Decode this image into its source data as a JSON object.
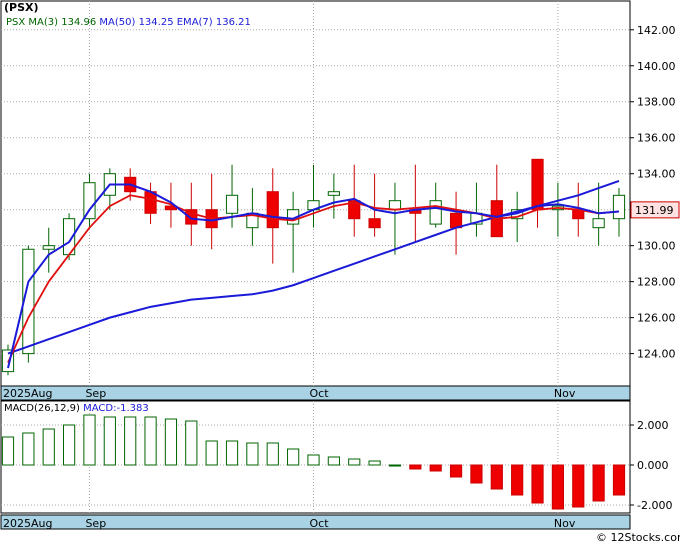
{
  "chart_data": [
    {
      "type": "candlestick",
      "title": "(PSX)",
      "ticker": "PSX",
      "legend": [
        {
          "label": "MA(3)",
          "value": "134.96",
          "color": "#2a2ad8"
        },
        {
          "label": "MA(50)",
          "value": "134.25",
          "color": "#2a2ad8"
        },
        {
          "label": "EMA(7)",
          "value": "136.21",
          "color": "#2a2ad8"
        }
      ],
      "ylim": [
        122.2,
        143.6
      ],
      "yticks": [
        "142.00",
        "140.00",
        "138.00",
        "136.00",
        "134.00",
        "132.00",
        "130.00",
        "128.00",
        "126.00",
        "124.00"
      ],
      "ytick_values": [
        142,
        140,
        138,
        136,
        134,
        132,
        130,
        128,
        126,
        124
      ],
      "last_price": "131.99",
      "xlabels": [
        {
          "label": "2025Aug",
          "index": 0
        },
        {
          "label": "Sep",
          "index": 4
        },
        {
          "label": "Oct",
          "index": 15
        },
        {
          "label": "Nov",
          "index": 27
        }
      ],
      "ohlc": [
        [
          123,
          124.5,
          122.8,
          124.2
        ],
        [
          124,
          130,
          123.5,
          129.8
        ],
        [
          129.8,
          131,
          128.5,
          130
        ],
        [
          129.5,
          131.8,
          129.2,
          131.5
        ],
        [
          131.5,
          134,
          131,
          133.5
        ],
        [
          132.8,
          134.3,
          132,
          134
        ],
        [
          133.8,
          134.3,
          132.5,
          133
        ],
        [
          133,
          133.5,
          131.2,
          131.8
        ],
        [
          132.2,
          133.5,
          131,
          132
        ],
        [
          132,
          133.5,
          130,
          131.2
        ],
        [
          132,
          134,
          129.8,
          131
        ],
        [
          131.8,
          134.5,
          131,
          132.8
        ],
        [
          131,
          133.2,
          130,
          131.8
        ],
        [
          133,
          134.3,
          129,
          131
        ],
        [
          131.2,
          133,
          128.5,
          132
        ],
        [
          132,
          134.5,
          131,
          132.5
        ],
        [
          132.8,
          134,
          131.5,
          133
        ],
        [
          132.5,
          134.5,
          130.5,
          131.5
        ],
        [
          131.5,
          134,
          130.5,
          131
        ],
        [
          132,
          133.5,
          129.5,
          132.5
        ],
        [
          132,
          134.5,
          130.2,
          131.8
        ],
        [
          131.2,
          133.5,
          131,
          132.5
        ],
        [
          131.8,
          133,
          129.5,
          131
        ],
        [
          131.2,
          133.5,
          130.5,
          131.8
        ],
        [
          132.5,
          134.5,
          130.8,
          130.5
        ],
        [
          131.5,
          133,
          130.2,
          132
        ],
        [
          134.8,
          134.5,
          131,
          132
        ],
        [
          132,
          133.5,
          130.5,
          132.2
        ],
        [
          132,
          133.5,
          130.5,
          131.5
        ],
        [
          131,
          133.5,
          130,
          131.5
        ],
        [
          131.5,
          133.2,
          130.5,
          132.8
        ]
      ],
      "ma3": [
        123.2,
        128,
        129.5,
        130.2,
        132,
        133.4,
        133.4,
        133,
        132.4,
        131.5,
        131.4,
        131.6,
        131.8,
        131.6,
        131.5,
        132,
        132.4,
        132.6,
        132,
        131.8,
        132,
        132.1,
        131.9,
        131.8,
        131.6,
        131.8,
        132.2,
        132.3,
        132.1,
        131.8,
        131.9
      ],
      "ma50": [
        124,
        124.4,
        124.8,
        125.2,
        125.6,
        126,
        126.3,
        126.6,
        126.8,
        127,
        127.1,
        127.2,
        127.3,
        127.5,
        127.8,
        128.2,
        128.6,
        129,
        129.4,
        129.8,
        130.2,
        130.6,
        131,
        131.3,
        131.6,
        131.9,
        132.2,
        132.5,
        132.8,
        133.2,
        133.6
      ],
      "ema7": [
        123.5,
        126,
        128,
        129.5,
        131,
        132.2,
        132.8,
        132.6,
        132.3,
        131.8,
        131.5,
        131.6,
        131.7,
        131.5,
        131.4,
        131.8,
        132.2,
        132.4,
        132.1,
        132,
        132.1,
        132.2,
        132,
        131.8,
        131.5,
        131.6,
        132,
        132.1,
        132,
        131.8,
        131.9
      ]
    },
    {
      "type": "bar",
      "title": "MACD(26,12,9)",
      "legend": [
        {
          "label": "MACD(26,12,9)",
          "value": "",
          "color": "#006400"
        },
        {
          "label": "MACD:",
          "value": "-1.383",
          "color": "#2a2ad8"
        }
      ],
      "ylim": [
        -2.4,
        3.2
      ],
      "yticks": [
        "2.000",
        "0.000",
        "-2.000"
      ],
      "ytick_values": [
        2,
        0,
        -2
      ],
      "values": [
        1.4,
        1.6,
        1.8,
        2.0,
        2.5,
        2.4,
        2.4,
        2.4,
        2.3,
        2.2,
        1.2,
        1.2,
        1.1,
        1.1,
        0.8,
        0.5,
        0.4,
        0.3,
        0.2,
        0.0,
        -0.2,
        -0.3,
        -0.6,
        -0.9,
        -1.2,
        -1.5,
        -1.9,
        -2.2,
        -2.1,
        -1.8,
        -1.5
      ]
    }
  ]
}
